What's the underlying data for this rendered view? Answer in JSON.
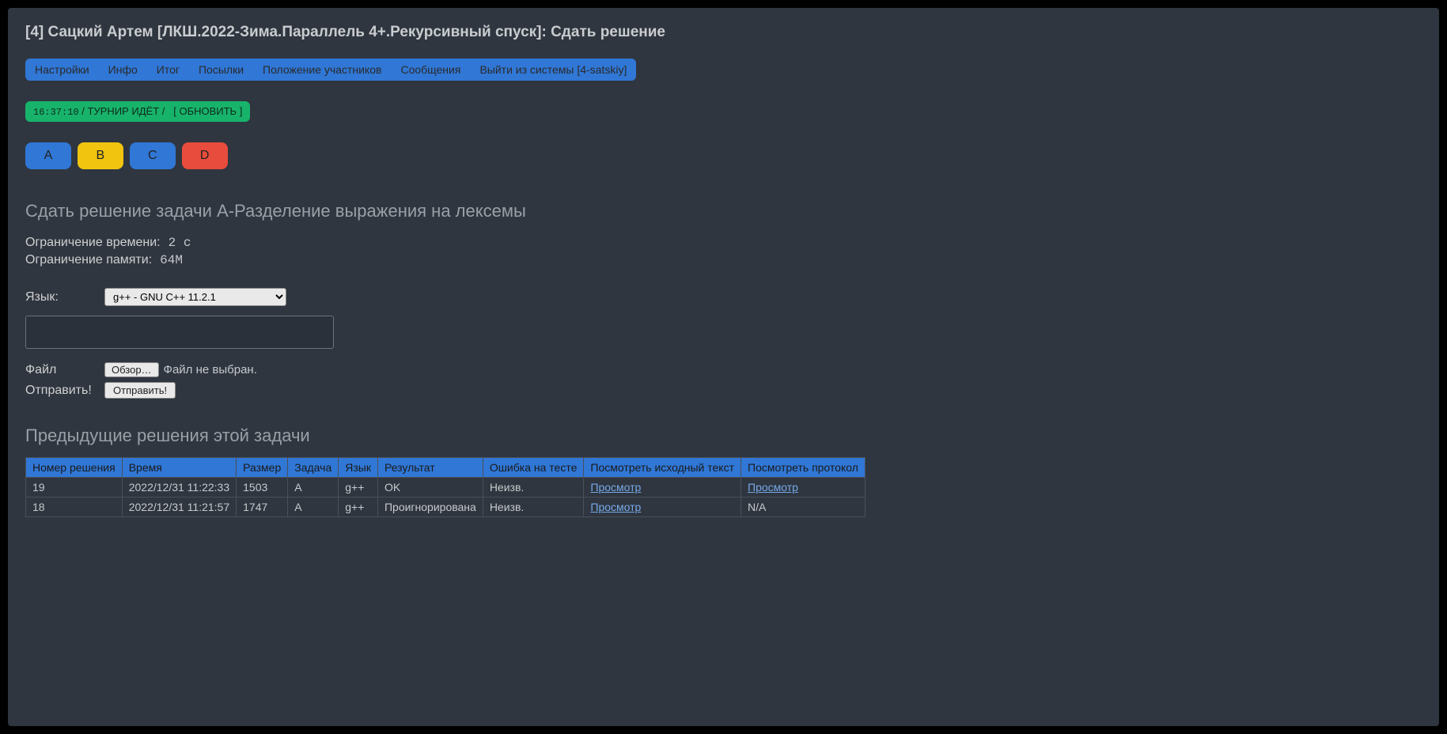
{
  "header": {
    "title": "[4] Сацкий Артем [ЛКШ.2022-Зима.Параллель 4+.Рекурсивный спуск]: Сдать решение"
  },
  "nav": {
    "items": [
      "Настройки",
      "Инфо",
      "Итог",
      "Посылки",
      "Положение участников",
      "Сообщения",
      "Выйти из системы [4-satskiy]"
    ]
  },
  "status": {
    "time": "16:37:10",
    "sep1": "/",
    "state": "ТУРНИР ИДЁТ",
    "sep2": "/",
    "refresh": "[ ОБНОВИТЬ ]"
  },
  "problems": [
    {
      "label": "A",
      "cls": "prob-blue"
    },
    {
      "label": "B",
      "cls": "prob-yellow"
    },
    {
      "label": "C",
      "cls": "prob-blue"
    },
    {
      "label": "D",
      "cls": "prob-red"
    }
  ],
  "submission": {
    "title": "Сдать решение задачи A-Разделение выражения на лексемы",
    "time_limit_label": "Ограничение времени:",
    "time_limit_value": "2 с",
    "mem_limit_label": "Ограничение памяти:",
    "mem_limit_value": "64M",
    "lang_label": "Язык:",
    "lang_value": "g++ - GNU C++ 11.2.1",
    "file_label": "Файл",
    "file_button": "Обзор…",
    "file_status": "Файл не выбран.",
    "submit_label": "Отправить!",
    "submit_button": "Отправить!"
  },
  "previous": {
    "title": "Предыдущие решения этой задачи",
    "headers": [
      "Номер решения",
      "Время",
      "Размер",
      "Задача",
      "Язык",
      "Результат",
      "Ошибка на тесте",
      "Посмотреть исходный текст",
      "Посмотреть протокол"
    ],
    "rows": [
      {
        "num": "19",
        "time": "2022/12/31 11:22:33",
        "size": "1503",
        "task": "A",
        "lang": "g++",
        "result": "OK",
        "err": "Неизв.",
        "src": "Просмотр",
        "proto": "Просмотр"
      },
      {
        "num": "18",
        "time": "2022/12/31 11:21:57",
        "size": "1747",
        "task": "A",
        "lang": "g++",
        "result": "Проигнорирована",
        "err": "Неизв.",
        "src": "Просмотр",
        "proto": "N/A"
      }
    ]
  }
}
